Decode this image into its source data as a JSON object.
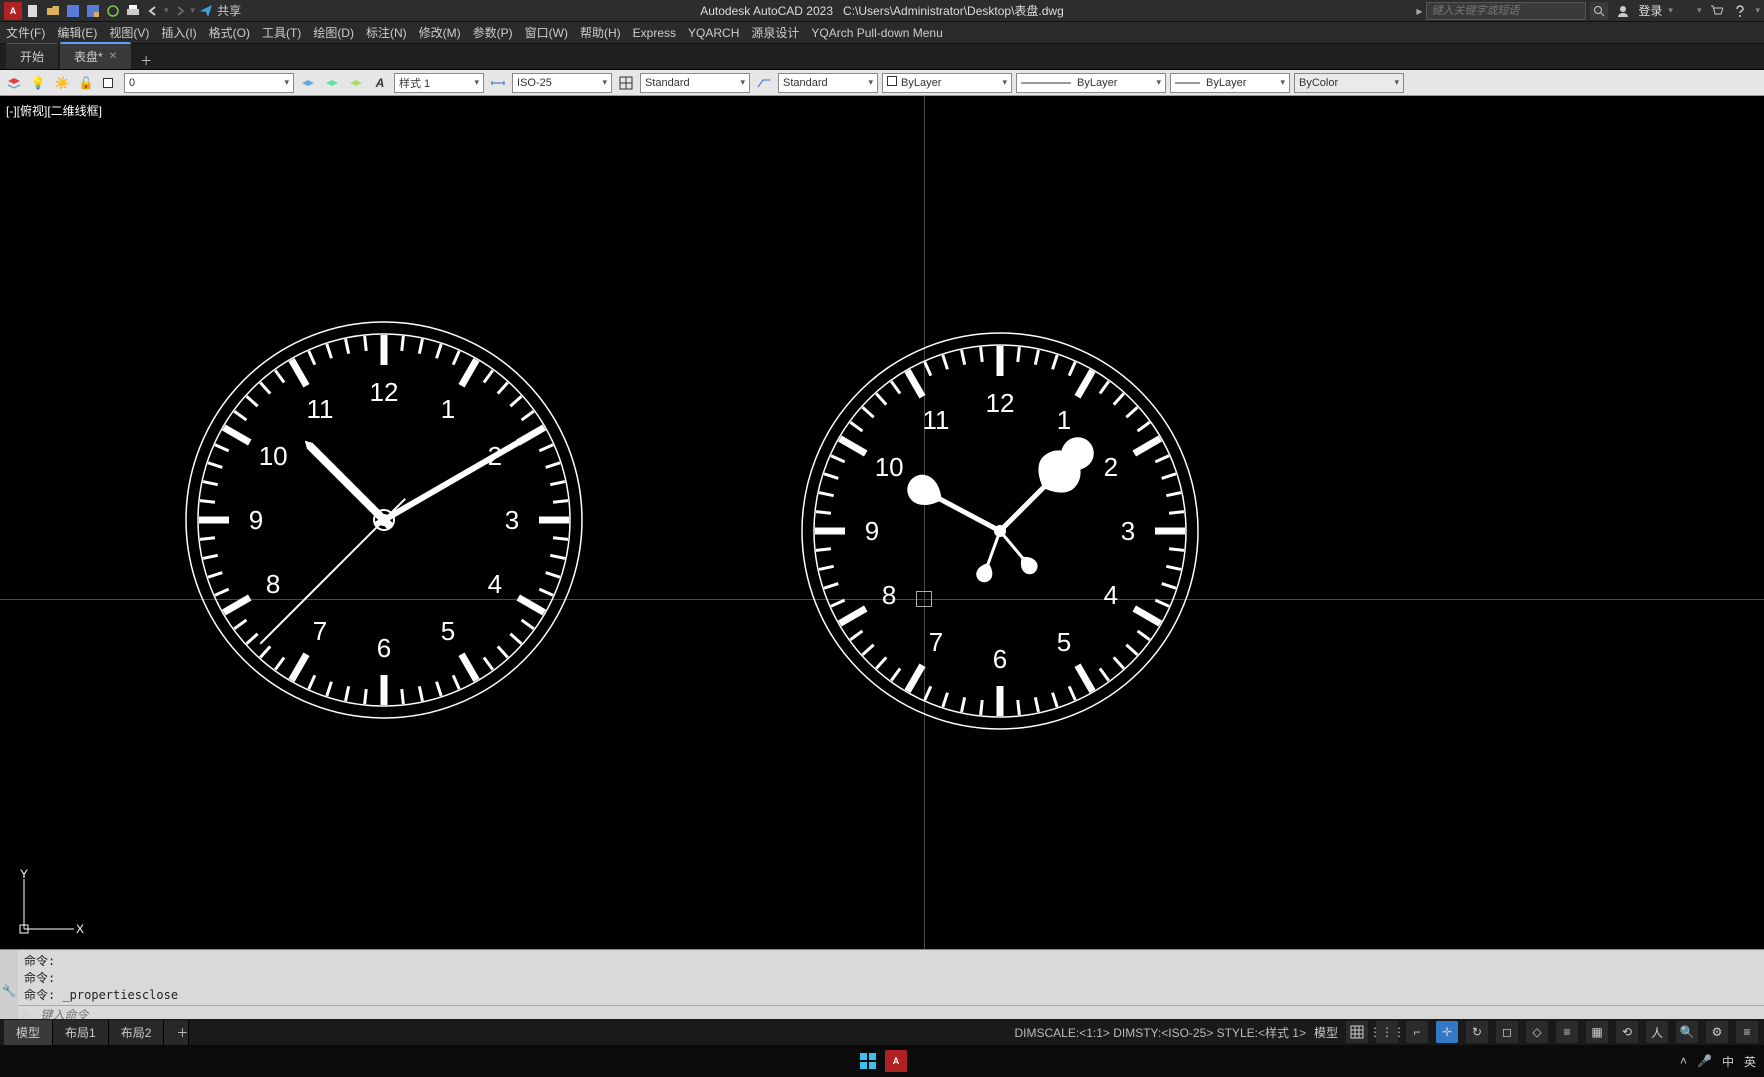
{
  "app": {
    "name": "Autodesk AutoCAD 2023",
    "file_path": "C:\\Users\\Administrator\\Desktop\\表盘.dwg"
  },
  "qat": {
    "share_label": "共享",
    "search_placeholder": "键入关键字或短语",
    "login_label": "登录"
  },
  "menus": [
    "文件(F)",
    "编辑(E)",
    "视图(V)",
    "插入(I)",
    "格式(O)",
    "工具(T)",
    "绘图(D)",
    "标注(N)",
    "修改(M)",
    "参数(P)",
    "窗口(W)",
    "帮助(H)",
    "Express",
    "YQARCH",
    "源泉设计",
    "YQArch Pull-down Menu"
  ],
  "doc_tabs": {
    "items": [
      "开始",
      "表盘*"
    ],
    "active_index": 1
  },
  "props": {
    "layer_value": "0",
    "style_combo": "样式 1",
    "dim_combo": "ISO-25",
    "text_combo": "Standard",
    "tbl_combo": "Standard",
    "color_combo": "ByLayer",
    "ltype_combo": "ByLayer",
    "lweight_combo": "ByLayer",
    "plot_combo": "ByColor"
  },
  "viewport_label": "[-][俯视][二维线框]",
  "ucs": {
    "x": "X",
    "y": "Y"
  },
  "cmd": {
    "history": [
      "命令:",
      "命令:",
      "命令: _propertiesclose"
    ],
    "prompt_icon": ">_",
    "input_placeholder": "键入命令"
  },
  "layout_tabs": [
    "模型",
    "布局1",
    "布局2"
  ],
  "status_text": "DIMSCALE:<1:1> DIMSTY:<ISO-25> STYLE:<样式 1>",
  "status_model": "模型",
  "taskbar": {
    "ime_lang": "英",
    "ime_ch": "中"
  },
  "clocks": {
    "numerals": [
      "12",
      "1",
      "2",
      "3",
      "4",
      "5",
      "6",
      "7",
      "8",
      "9",
      "10",
      "11"
    ]
  }
}
